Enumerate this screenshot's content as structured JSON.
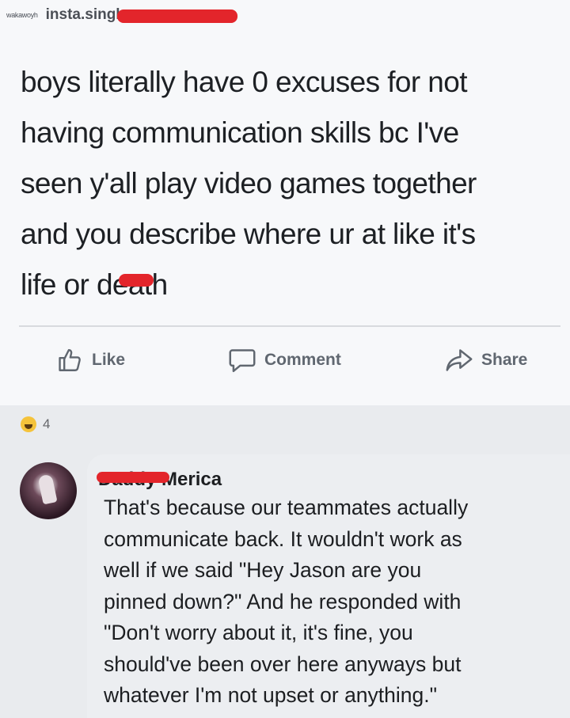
{
  "post": {
    "source_tiny": "wakawoyh",
    "source_name": "insta.single",
    "text": "boys literally have 0 excuses for not\nhaving communication skills bc I've\nseen y'all play video games together\nand you describe where ur at like it's\nlife or death"
  },
  "actions": {
    "like_label": "Like",
    "comment_label": "Comment",
    "share_label": "Share"
  },
  "reactions": {
    "emoji": "haha-emoji",
    "count": "4"
  },
  "comment": {
    "author": "Daddy Merica",
    "text": "That's because our teammates actually\ncommunicate back. It wouldn't work as\nwell if we said \"Hey Jason are you\npinned down?\" And he responded with\n\"Don't worry about it, it's fine, you\nshould've been over here anyways but\nwhatever I'm not upset or anything.\""
  },
  "colors": {
    "redaction": "#e3252b",
    "action_text": "#606770"
  }
}
